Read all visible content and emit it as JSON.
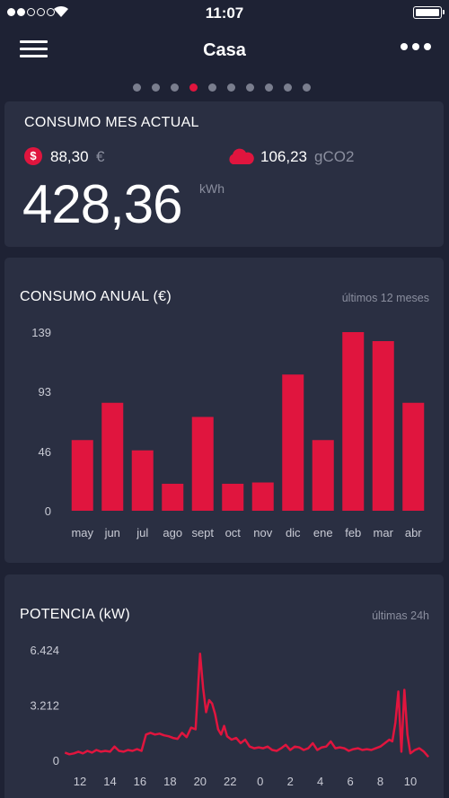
{
  "status": {
    "time": "11:07",
    "signal_bars_filled": 2,
    "signal_bars_total": 5
  },
  "nav": {
    "title": "Casa",
    "menu_icon": "hamburger-icon",
    "more_icon": "more-icon"
  },
  "pager": {
    "count": 10,
    "active_index": 3
  },
  "colors": {
    "accent": "#e0153e",
    "card": "#2a2f42",
    "background": "#1e2234"
  },
  "current_month": {
    "title": "CONSUMO MES ACTUAL",
    "cost_value": "88,30",
    "cost_unit": "€",
    "co2_value": "106,23",
    "co2_unit": "gCO2",
    "energy_value": "428,36",
    "energy_unit": "kWh"
  },
  "annual": {
    "title": "CONSUMO ANUAL (€)",
    "subtitle": "últimos 12 meses"
  },
  "power": {
    "title": "POTENCIA (kW)",
    "subtitle": "últimas 24h"
  },
  "chart_data": [
    {
      "type": "bar",
      "categories": [
        "may",
        "jun",
        "jul",
        "ago",
        "sept",
        "oct",
        "nov",
        "dic",
        "ene",
        "feb",
        "mar",
        "abr"
      ],
      "values": [
        55,
        84,
        47,
        21,
        73,
        21,
        22,
        106,
        55,
        139,
        132,
        84
      ],
      "ylim": [
        0,
        139
      ],
      "yticks": [
        "0",
        "46",
        "93",
        "139"
      ],
      "ytick_values": [
        0,
        46,
        93,
        139
      ],
      "color": "#e0153e",
      "grid": false
    },
    {
      "type": "line",
      "xticks": [
        "12",
        "14",
        "16",
        "18",
        "20",
        "22",
        "0",
        "2",
        "4",
        "6",
        "8",
        "10"
      ],
      "ylim": [
        0,
        6.424
      ],
      "yticks": [
        "0",
        "3.212",
        "6.424"
      ],
      "ytick_values": [
        0,
        3.212,
        6.424
      ],
      "x": [
        11.0,
        11.3,
        11.6,
        11.9,
        12.2,
        12.5,
        12.8,
        13.1,
        13.4,
        13.7,
        14.0,
        14.3,
        14.6,
        14.9,
        15.2,
        15.5,
        15.8,
        16.1,
        16.4,
        16.7,
        17.0,
        17.3,
        17.6,
        17.9,
        18.2,
        18.5,
        18.8,
        19.1,
        19.4,
        19.7,
        20.0,
        20.2,
        20.4,
        20.6,
        20.8,
        21.0,
        21.2,
        21.4,
        21.6,
        21.8,
        22.1,
        22.4,
        22.7,
        23.0,
        23.3,
        23.6,
        23.9,
        24.2,
        24.5,
        24.8,
        25.1,
        25.4,
        25.7,
        26.0,
        26.3,
        26.6,
        26.9,
        27.2,
        27.5,
        27.8,
        28.1,
        28.4,
        28.7,
        29.0,
        29.3,
        29.6,
        29.9,
        30.2,
        30.5,
        30.8,
        31.1,
        31.4,
        31.7,
        32.0,
        32.3,
        32.6,
        32.8,
        33.0,
        33.2,
        33.4,
        33.6,
        33.8,
        34.0,
        34.3,
        34.6,
        34.9,
        35.2
      ],
      "y": [
        0.45,
        0.35,
        0.4,
        0.5,
        0.4,
        0.55,
        0.45,
        0.6,
        0.5,
        0.55,
        0.5,
        0.8,
        0.55,
        0.5,
        0.6,
        0.55,
        0.65,
        0.55,
        1.5,
        1.6,
        1.5,
        1.55,
        1.45,
        1.4,
        1.3,
        1.25,
        1.6,
        1.35,
        1.9,
        1.8,
        6.2,
        4.2,
        2.8,
        3.5,
        3.3,
        2.7,
        1.8,
        1.5,
        2.0,
        1.4,
        1.2,
        1.3,
        1.0,
        1.2,
        0.8,
        0.7,
        0.75,
        0.7,
        0.8,
        0.6,
        0.55,
        0.7,
        0.9,
        0.6,
        0.8,
        0.75,
        0.6,
        0.7,
        1.0,
        0.6,
        0.75,
        0.8,
        1.1,
        0.7,
        0.75,
        0.7,
        0.55,
        0.65,
        0.7,
        0.6,
        0.65,
        0.6,
        0.7,
        0.8,
        1.0,
        1.2,
        1.1,
        2.2,
        4.0,
        0.5,
        4.1,
        1.5,
        0.4,
        0.6,
        0.7,
        0.5,
        0.2
      ],
      "color": "#e0153e",
      "grid": false
    }
  ]
}
